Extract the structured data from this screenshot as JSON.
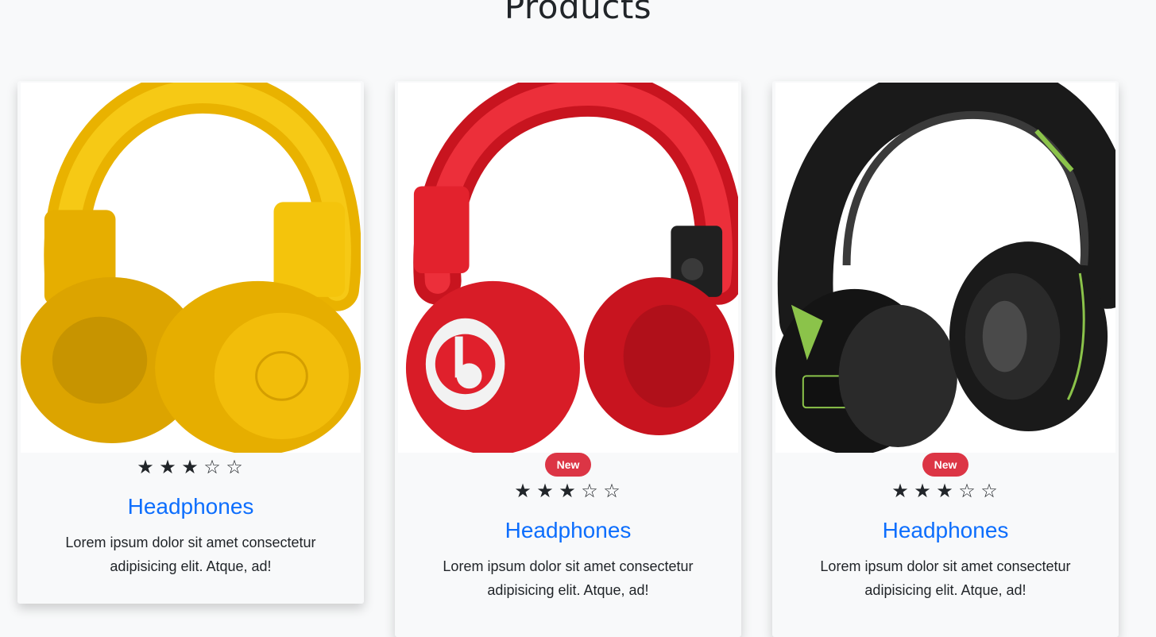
{
  "page": {
    "title": "Products"
  },
  "products": [
    {
      "color": "#f2bd0a",
      "badge": "",
      "rating": 3,
      "max_rating": 5,
      "title": "Headphones",
      "description": "Lorem ipsum dolor sit amet consectetur adipisicing elit. Atque, ad!"
    },
    {
      "color": "#e0202c",
      "badge": "New",
      "rating": 3,
      "max_rating": 5,
      "title": "Headphones",
      "description": "Lorem ipsum dolor sit amet consectetur adipisicing elit. Atque, ad!"
    },
    {
      "color": "#1f1f1f",
      "badge": "New",
      "rating": 3,
      "max_rating": 5,
      "title": "Headphones",
      "description": "Lorem ipsum dolor sit amet consectetur adipisicing elit. Atque, ad!"
    }
  ],
  "colors": {
    "link": "#0d6efd",
    "badge": "#dc3545",
    "accent_green": "#8bc34a"
  },
  "icons": {
    "star_filled": "star-filled-icon",
    "star_empty": "star-empty-icon"
  }
}
